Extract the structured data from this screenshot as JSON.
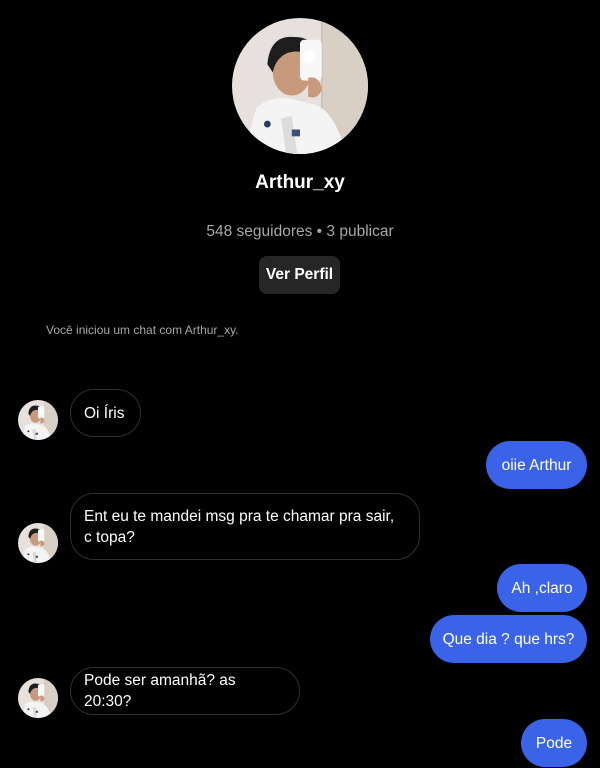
{
  "profile": {
    "username": "Arthur_xy",
    "stats": "548 seguidores • 3 publicar",
    "view_profile_label": "Ver Perfil"
  },
  "system": {
    "chat_started": "Você iniciou um chat com Arthur_xy."
  },
  "messages": [
    {
      "sender": "them",
      "text": "Oi Íris"
    },
    {
      "sender": "me",
      "text": "oiie Arthur"
    },
    {
      "sender": "them",
      "text": "Ent eu te mandei msg pra te chamar pra sair, c topa?"
    },
    {
      "sender": "me",
      "text": "Ah ,claro"
    },
    {
      "sender": "me",
      "text": "Que dia ? que hrs?"
    },
    {
      "sender": "them",
      "text": "Pode ser amanhã? as 20:30?"
    },
    {
      "sender": "me",
      "text": "Pode"
    }
  ],
  "colors": {
    "background": "#000000",
    "outgoing_bubble": "#3b63e8",
    "incoming_border": "#2f2f2f",
    "button_bg": "#262626",
    "secondary_text": "#a8a8a8"
  }
}
